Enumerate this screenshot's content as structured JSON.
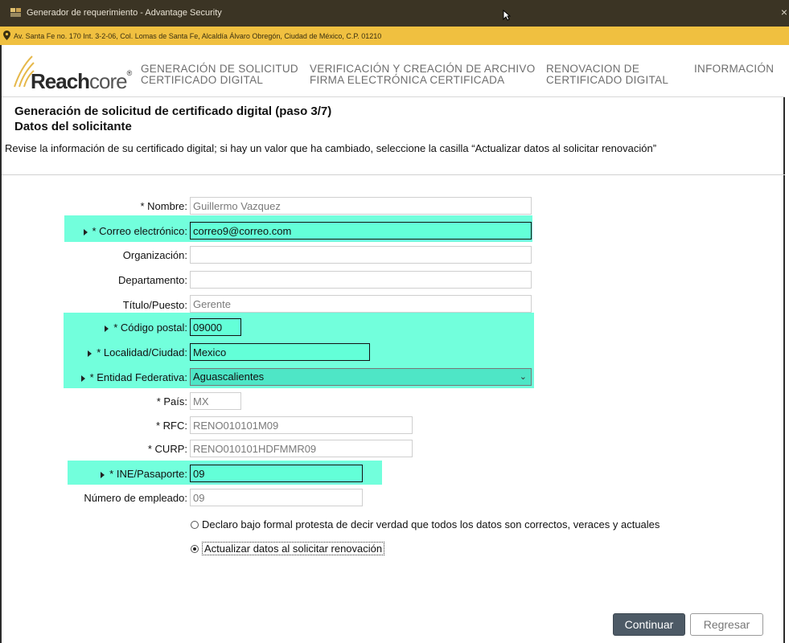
{
  "window": {
    "title": "Generador de requerimiento - Advantage Security",
    "close_glyph": "×"
  },
  "address": {
    "text": "Av. Santa Fe no. 170 Int. 3-2-06, Col. Lomas de Santa Fe, Alcaldía Álvaro Obregón, Ciudad de México, C.P. 01210"
  },
  "logo": {
    "brand_bold": "Reach",
    "brand_light": "core",
    "reg": "®"
  },
  "nav": {
    "items": [
      {
        "line1": "GENERACIÓN DE SOLICITUD",
        "line2": "CERTIFICADO DIGITAL"
      },
      {
        "line1": "VERIFICACIÓN Y CREACIÓN DE ARCHIVO",
        "line2": "FIRMA ELECTRÓNICA CERTIFICADA"
      },
      {
        "line1": "RENOVACION DE",
        "line2": "CERTIFICADO DIGITAL"
      },
      {
        "line1": "INFORMACIÓN",
        "line2": ""
      }
    ]
  },
  "page": {
    "title": "Generación de solicitud de certificado digital (paso 3/7)",
    "subtitle": "Datos del solicitante",
    "instructions": "Revise la información de su certificado digital; si hay un valor que ha cambiado, seleccione la casilla “Actualizar datos al solicitar renovación”"
  },
  "form": {
    "nombre": {
      "label": "* Nombre:",
      "value": "Guillermo Vazquez"
    },
    "correo": {
      "label": "* Correo electrónico:",
      "value": "correo9@correo.com"
    },
    "organizacion": {
      "label": "Organización:",
      "value": ""
    },
    "departamento": {
      "label": "Departamento:",
      "value": ""
    },
    "titulo": {
      "label": "Título/Puesto:",
      "value": "Gerente"
    },
    "cp": {
      "label": "* Código postal:",
      "value": "09000"
    },
    "localidad": {
      "label": "* Localidad/Ciudad:",
      "value": "Mexico"
    },
    "entidad": {
      "label": "* Entidad Federativa:",
      "value": "Aguascalientes"
    },
    "pais": {
      "label": "* País:",
      "value": "MX"
    },
    "rfc": {
      "label": "* RFC:",
      "value": "RENO010101M09"
    },
    "curp": {
      "label": "* CURP:",
      "value": "RENO010101HDFMMR09"
    },
    "ine": {
      "label": "* INE/Pasaporte:",
      "value": "09"
    },
    "empleado": {
      "label": "Número de empleado:",
      "value": "09"
    }
  },
  "options": {
    "declaro": "Declaro bajo formal protesta de decir verdad que todos los datos son correctos, veraces y actuales",
    "actualizar": "Actualizar datos al solicitar renovación",
    "selected": "actualizar"
  },
  "buttons": {
    "continuar": "Continuar",
    "regresar": "Regresar"
  },
  "colors": {
    "highlight": "#63ffd8",
    "titlebar": "#3b3424",
    "addressbar": "#f0c040",
    "primary_button": "#4d5a66"
  }
}
